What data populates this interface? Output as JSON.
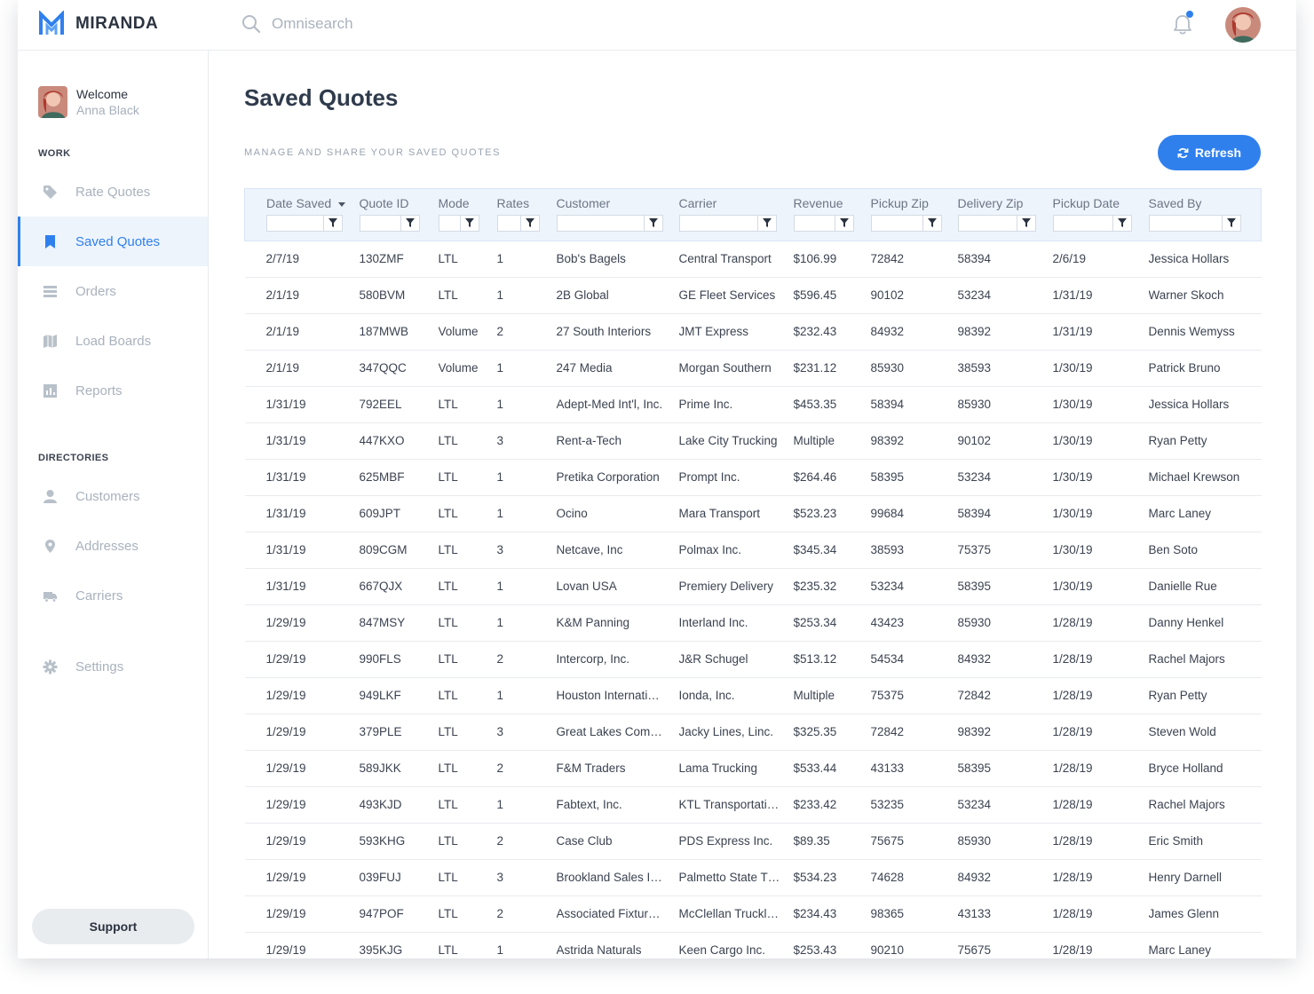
{
  "app": {
    "name": "MIRANDA"
  },
  "search": {
    "placeholder": "Omnisearch"
  },
  "colors": {
    "accent": "#2f80ed",
    "header_bg": "#eef4fc"
  },
  "user": {
    "welcome": "Welcome",
    "name": "Anna Black"
  },
  "sidebar": {
    "work_label": "WORK",
    "directories_label": "DIRECTORIES",
    "items": [
      {
        "label": "Rate Quotes",
        "icon": "tag-icon"
      },
      {
        "label": "Saved Quotes",
        "icon": "bookmark-icon",
        "active": true
      },
      {
        "label": "Orders",
        "icon": "list-icon"
      },
      {
        "label": "Load Boards",
        "icon": "map-icon"
      },
      {
        "label": "Reports",
        "icon": "bar-chart-icon"
      },
      {
        "label": "Customers",
        "icon": "person-icon"
      },
      {
        "label": "Addresses",
        "icon": "location-pin-icon"
      },
      {
        "label": "Carriers",
        "icon": "truck-icon"
      },
      {
        "label": "Settings",
        "icon": "gear-icon"
      }
    ],
    "support_label": "Support"
  },
  "main": {
    "title": "Saved Quotes",
    "subtitle": "MANAGE AND SHARE YOUR SAVED QUOTES",
    "refresh_label": "Refresh"
  },
  "table": {
    "columns": [
      "Date Saved",
      "Quote ID",
      "Mode",
      "Rates",
      "Customer",
      "Carrier",
      "Revenue",
      "Pickup Zip",
      "Delivery Zip",
      "Pickup Date",
      "Saved By"
    ],
    "sorted_column": "Date Saved",
    "rows": [
      [
        "2/7/19",
        "130ZMF",
        "LTL",
        "1",
        "Bob's Bagels",
        "Central Transport",
        "$106.99",
        "72842",
        "58394",
        "2/6/19",
        "Jessica Hollars"
      ],
      [
        "2/1/19",
        "580BVM",
        "LTL",
        "1",
        "2B Global",
        "GE Fleet Services",
        "$596.45",
        "90102",
        "53234",
        "1/31/19",
        "Warner Skoch"
      ],
      [
        "2/1/19",
        "187MWB",
        "Volume",
        "2",
        "27 South Interiors",
        "JMT Express",
        "$232.43",
        "84932",
        "98392",
        "1/31/19",
        "Dennis Wemyss"
      ],
      [
        "2/1/19",
        "347QQC",
        "Volume",
        "1",
        "247 Media",
        "Morgan Southern",
        "$231.12",
        "85930",
        "38593",
        "1/30/19",
        "Patrick Bruno"
      ],
      [
        "1/31/19",
        "792EEL",
        "LTL",
        "1",
        "Adept-Med Int'l, Inc.",
        "Prime Inc.",
        "$453.35",
        "58394",
        "85930",
        "1/30/19",
        "Jessica Hollars"
      ],
      [
        "1/31/19",
        "447KXO",
        "LTL",
        "3",
        "Rent-a-Tech",
        "Lake City Trucking",
        "Multiple",
        "98392",
        "90102",
        "1/30/19",
        "Ryan Petty"
      ],
      [
        "1/31/19",
        "625MBF",
        "LTL",
        "1",
        "Pretika Corporation",
        "Prompt Inc.",
        "$264.46",
        "58395",
        "53234",
        "1/30/19",
        "Michael Krewson"
      ],
      [
        "1/31/19",
        "609JPT",
        "LTL",
        "1",
        "Ocino",
        "Mara Transport",
        "$523.23",
        "99684",
        "58394",
        "1/30/19",
        "Marc Laney"
      ],
      [
        "1/31/19",
        "809CGM",
        "LTL",
        "3",
        "Netcave, Inc",
        "Polmax Inc.",
        "$345.34",
        "38593",
        "75375",
        "1/30/19",
        "Ben Soto"
      ],
      [
        "1/31/19",
        "667QJX",
        "LTL",
        "1",
        "Lovan USA",
        "Premiery Delivery",
        "$235.32",
        "53234",
        "58395",
        "1/30/19",
        "Danielle Rue"
      ],
      [
        "1/29/19",
        "847MSY",
        "LTL",
        "1",
        "K&M Panning",
        "Interland Inc.",
        "$253.34",
        "43423",
        "85930",
        "1/28/19",
        "Danny Henkel"
      ],
      [
        "1/29/19",
        "990FLS",
        "LTL",
        "2",
        "Intercorp, Inc.",
        "J&R Schugel",
        "$513.12",
        "54534",
        "84932",
        "1/28/19",
        "Rachel Majors"
      ],
      [
        "1/29/19",
        "949LKF",
        "LTL",
        "1",
        "Houston Internati…",
        "Ionda, Inc.",
        "Multiple",
        "75375",
        "72842",
        "1/28/19",
        "Ryan Petty"
      ],
      [
        "1/29/19",
        "379PLE",
        "LTL",
        "3",
        "Great Lakes Com…",
        "Jacky Lines, Linc.",
        "$325.35",
        "72842",
        "98392",
        "1/28/19",
        "Steven Wold"
      ],
      [
        "1/29/19",
        "589JKK",
        "LTL",
        "2",
        "F&M Traders",
        "Lama Trucking",
        "$533.44",
        "43133",
        "58395",
        "1/28/19",
        "Bryce Holland"
      ],
      [
        "1/29/19",
        "493KJD",
        "LTL",
        "1",
        "Fabtext, Inc.",
        "KTL Transportati…",
        "$233.42",
        "53235",
        "53234",
        "1/28/19",
        "Rachel Majors"
      ],
      [
        "1/29/19",
        "593KHG",
        "LTL",
        "2",
        "Case Club",
        "PDS Express Inc.",
        "$89.35",
        "75675",
        "85930",
        "1/28/19",
        "Eric Smith"
      ],
      [
        "1/29/19",
        "039FUJ",
        "LTL",
        "3",
        "Brookland Sales I…",
        "Palmetto State T…",
        "$534.23",
        "74628",
        "84932",
        "1/28/19",
        "Henry Darnell"
      ],
      [
        "1/29/19",
        "947POF",
        "LTL",
        "2",
        "Associated Fixtur…",
        "McClellan Truckl…",
        "$234.43",
        "98365",
        "43133",
        "1/28/19",
        "James Glenn"
      ],
      [
        "1/29/19",
        "395KJG",
        "LTL",
        "1",
        "Astrida Naturals",
        "Keen Cargo Inc.",
        "$253.43",
        "90210",
        "75675",
        "1/28/19",
        "Marc Laney"
      ]
    ]
  }
}
